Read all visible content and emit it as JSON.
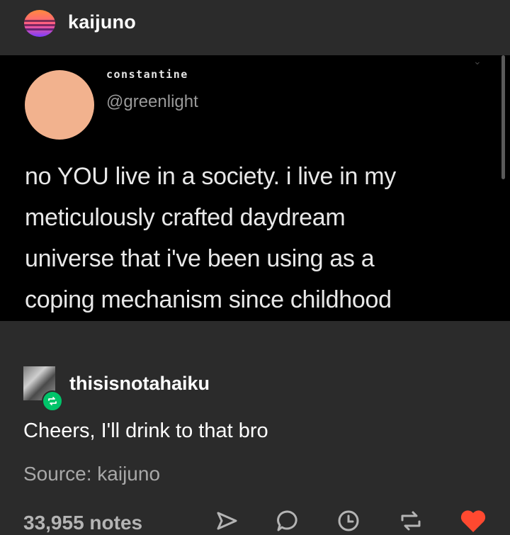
{
  "post": {
    "author": "kaijuno",
    "avatar_icon": "vaporwave-avatar",
    "colors": {
      "background": "#2b2b2b",
      "tweet_background": "#000000",
      "accent_green": "#00c46a",
      "like_red": "#ff4930"
    }
  },
  "tweet": {
    "display_name": "constantine",
    "handle": "@greenlight",
    "avatar_color": "#f2b28e",
    "text": "no YOU live in a society. i live in my meticulously crafted daydream universe that i've been using as a coping mechanism since childhood",
    "lines": [
      "no YOU live in a society. i live in my",
      "meticulously crafted daydream",
      "universe that i've been using as a",
      "coping mechanism since childhood"
    ]
  },
  "reblog": {
    "username": "thisisnotahaiku",
    "comment": "Cheers, I'll drink to that bro",
    "source_label": "Source:",
    "source_name": "kaijuno"
  },
  "footer": {
    "notes": "33,955 notes",
    "actions": [
      "share-icon",
      "reply-icon",
      "queue-icon",
      "reblog-icon",
      "like-icon"
    ]
  }
}
